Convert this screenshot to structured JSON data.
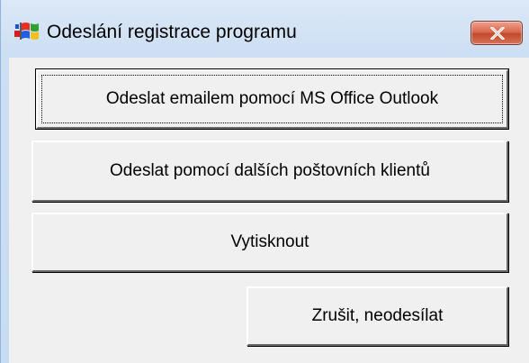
{
  "window": {
    "title": "Odeslání registrace programu",
    "icon": "windows-flag-icon",
    "close_icon": "close-icon"
  },
  "buttons": {
    "outlook": "Odeslat emailem pomocí MS Office Outlook",
    "other_clients": "Odeslat pomocí dalších poštovních klientů",
    "print": "Vytisknout",
    "cancel": "Zrušit, neodesílat"
  },
  "colors": {
    "close_button": "#c9553a",
    "frame": "#cddff3",
    "client": "#f0f0f0"
  }
}
